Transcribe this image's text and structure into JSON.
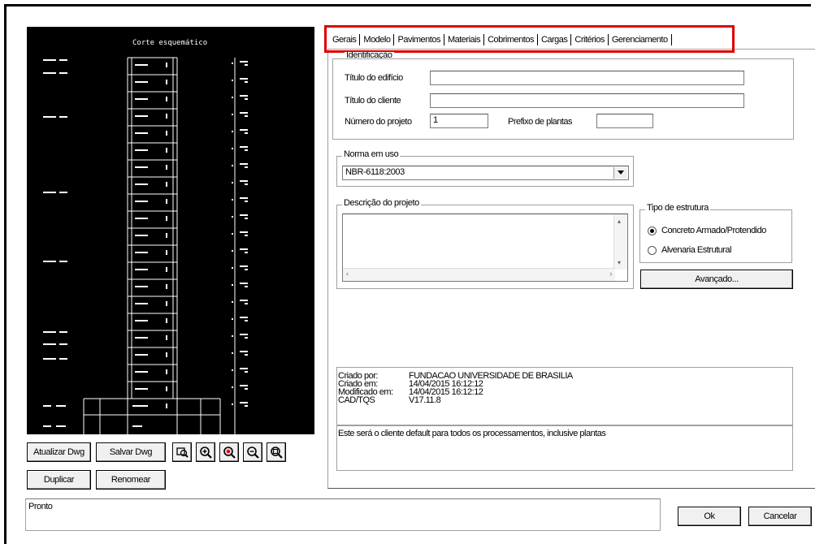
{
  "preview": {
    "title": "Corte esquemático"
  },
  "buttons": {
    "atualizar": "Atualizar Dwg",
    "salvar": "Salvar Dwg",
    "duplicar": "Duplicar",
    "renomear": "Renomear",
    "avancado": "Avançado...",
    "ok": "Ok",
    "cancelar": "Cancelar"
  },
  "tabs": [
    "Gerais",
    "Modelo",
    "Pavimentos",
    "Materiais",
    "Cobrimentos",
    "Cargas",
    "Critérios",
    "Gerenciamento"
  ],
  "identificacao": {
    "group_label": "Identificação",
    "titulo_edificio_label": "Título do edifício",
    "titulo_edificio_value": "",
    "titulo_cliente_label": "Título do cliente",
    "titulo_cliente_value": "",
    "numero_projeto_label": "Número do projeto",
    "numero_projeto_value": "1",
    "prefixo_label": "Prefixo de plantas",
    "prefixo_value": ""
  },
  "norma": {
    "group_label": "Norma em uso",
    "selected": "NBR-6118:2003"
  },
  "descricao": {
    "group_label": "Descrição do projeto",
    "value": ""
  },
  "tipo_estrutura": {
    "group_label": "Tipo de estrutura",
    "options": [
      "Concreto Armado/Protendido",
      "Alvenaria Estrutural"
    ],
    "selected_index": 0
  },
  "info": {
    "criado_por_label": "Criado por:",
    "criado_por_value": "FUNDACAO UNIVERSIDADE DE BRASILIA",
    "criado_em_label": "Criado em:",
    "criado_em_value": "14/04/2015 16:12:12",
    "modificado_label": "Modificado em:",
    "modificado_value": "14/04/2015 16:12:12",
    "cad_label": "CAD/TQS",
    "cad_value": "V17.11.8"
  },
  "hint": "Este será o cliente default para todos os processamentos, inclusive plantas",
  "status": "Pronto",
  "icons": [
    "zoom-window-icon",
    "zoom-in-icon",
    "zoom-extent-icon",
    "zoom-out-icon",
    "zoom-all-icon"
  ]
}
